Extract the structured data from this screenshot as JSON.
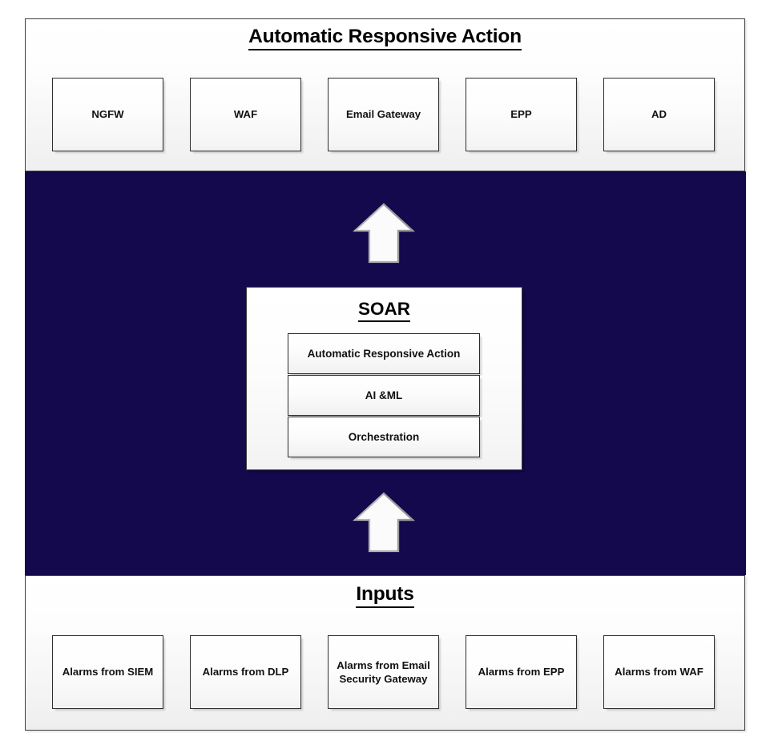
{
  "diagram": {
    "background_color": "#ffffff",
    "navy_color": "#14094d",
    "box_border_color": "#2e2e2e",
    "top_section": {
      "title": "Automatic Responsive Action",
      "nodes": [
        {
          "label": "NGFW"
        },
        {
          "label": "WAF"
        },
        {
          "label": "Email Gateway"
        },
        {
          "label": "EPP"
        },
        {
          "label": "AD"
        }
      ]
    },
    "middle_section": {
      "soar": {
        "title": "SOAR",
        "components": [
          {
            "label": "Automatic Responsive Action"
          },
          {
            "label": "AI &ML"
          },
          {
            "label": "Orchestration"
          }
        ]
      },
      "arrows": [
        {
          "name": "arrow-up-to-actions",
          "direction": "up"
        },
        {
          "name": "arrow-up-to-soar",
          "direction": "up"
        }
      ]
    },
    "bottom_section": {
      "title": "Inputs",
      "nodes": [
        {
          "label": "Alarms from SIEM"
        },
        {
          "label": "Alarms from DLP"
        },
        {
          "label": "Alarms from Email Security Gateway"
        },
        {
          "label": "Alarms from EPP"
        },
        {
          "label": "Alarms from WAF"
        }
      ]
    }
  }
}
